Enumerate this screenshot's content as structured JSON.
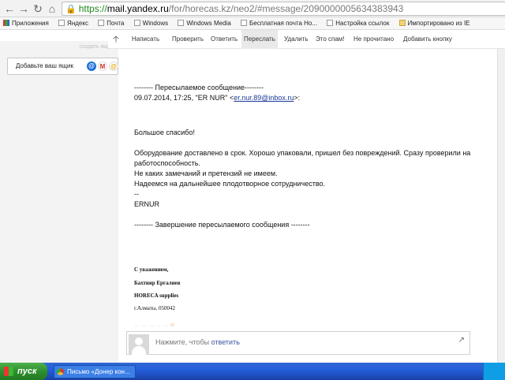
{
  "browser": {
    "url_scheme": "https://",
    "url_host": "mail.yandex.ru",
    "url_path": "/for/horecas.kz/neo2/#message/2090000005634383943"
  },
  "bookmarks": [
    {
      "label": "Приложения",
      "icon": "apps-grid-icon"
    },
    {
      "label": "Яндекс",
      "icon": "page-icon"
    },
    {
      "label": "Почта",
      "icon": "mail-icon"
    },
    {
      "label": "Windows",
      "icon": "page-icon"
    },
    {
      "label": "Windows Media",
      "icon": "page-icon"
    },
    {
      "label": "Бесплатная почта Ho...",
      "icon": "page-icon"
    },
    {
      "label": "Настройка ссылок",
      "icon": "page-icon"
    },
    {
      "label": "Импортировано из IE",
      "icon": "folder-icon"
    }
  ],
  "sidebar": {
    "create_link": "создать ящик",
    "add_mailbox": "Добавьте ваш ящик",
    "provider_icons": [
      "@",
      "M",
      "@"
    ]
  },
  "toolbar": {
    "items": [
      "Написать",
      "Проверить",
      "Ответить",
      "Переслать",
      "Удалить",
      "Это спам!",
      "Не прочитано",
      "Добавить кнопку"
    ],
    "active": "Переслать"
  },
  "message": {
    "fwd_header": "-------- Пересылаемое сообщение--------",
    "fwd_meta_prefix": "09.07.2014, 17:25, \"ER NUR\" <",
    "fwd_email": "er.nur.89@inbox.ru",
    "fwd_meta_suffix": ">:",
    "thanks": "Большое спасибо!",
    "p1a": "Оборудование доставлено в срок. Хорошо упаковали, пришел без повреждений. Сразу проверили на",
    "p1b": "работоспособность.",
    "p2": "Не каких замечаний и претензий не имеем.",
    "p3": "Надеемся на дальнейшее плодотворное сотрудничество.",
    "dashes": "--",
    "sender": "ERNUR",
    "fwd_footer": "-------- Завершение пересылаемого сообщения --------",
    "sig1": "С уважением,",
    "sig2": "Бахтияр Ергалиев",
    "sig3": "HORECA supplies",
    "sig4": "г.Алматы, 050042",
    "faded_text": "… … … … …"
  },
  "reply": {
    "prefix": "Нажмите, чтобы ",
    "action": "ответить"
  },
  "taskbar": {
    "start": "пуск",
    "window": "Письмо «Донер кон..."
  }
}
